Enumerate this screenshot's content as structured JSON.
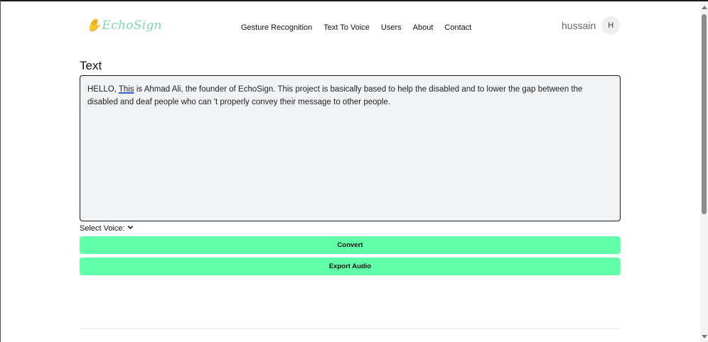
{
  "header": {
    "logo_text": "EchoSign",
    "nav": [
      "Gesture Recognition",
      "Text To Voice",
      "Users",
      "About",
      "Contact"
    ],
    "username": "hussain",
    "avatar_initial": "H"
  },
  "main": {
    "section_title": "Text",
    "textarea": {
      "text_before": "HELLO, ",
      "text_spell": "This",
      "text_after": " is Ahmad Ali, the founder of EchoSign. This project is basically based to help the disabled and to lower the gap between the disabled and deaf people who can 't properly convey their message to other people."
    },
    "voice_label": "Select Voice:",
    "convert_label": "Convert",
    "export_label": "Export Audio"
  },
  "colors": {
    "button_bg": "#61ffa9",
    "textarea_bg": "#f2f3f5",
    "logo": "#7fd6a8"
  }
}
